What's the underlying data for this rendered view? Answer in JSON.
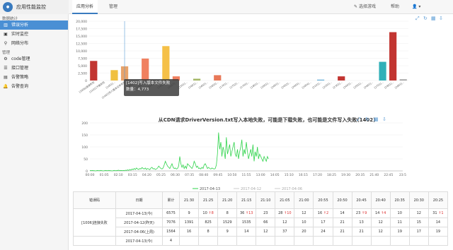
{
  "app": {
    "name": "应用性能监控"
  },
  "nav": {
    "tabs": [
      "应用分析",
      "管理"
    ],
    "right": [
      "选择游戏",
      "帮助"
    ]
  },
  "sidebar": {
    "sections": [
      {
        "title": "数据统计",
        "items": [
          {
            "label": "错误分析",
            "active": true,
            "icon": "chart-icon"
          },
          {
            "label": "实时监控",
            "active": false,
            "icon": "monitor-icon"
          },
          {
            "label": "网络分布",
            "active": false,
            "icon": "network-icon"
          }
        ]
      },
      {
        "title": "管理",
        "items": [
          {
            "label": "code管理",
            "active": false,
            "icon": "gear-icon"
          },
          {
            "label": "接口管理",
            "active": false,
            "icon": "list-icon"
          },
          {
            "label": "告警策略",
            "active": false,
            "icon": "policy-icon"
          },
          {
            "label": "告警查询",
            "active": false,
            "icon": "bell-icon"
          }
        ]
      }
    ]
  },
  "tooltip": {
    "line1": "[1402]写入版本文件失败",
    "line2": "数量：4,773"
  },
  "chart_data": [
    {
      "type": "bar",
      "title": "",
      "ylim": [
        0,
        20000
      ],
      "yticks": [
        "20,000",
        "17,500",
        "15,000",
        "12,500",
        "10,000",
        "7,500",
        "5,000",
        "2,500",
        "0"
      ],
      "categories": [
        "[1006]连接失败",
        "[1101]下载失败",
        "[1401]...",
        "[1402]写入版本文件失败",
        "[1403]...",
        "[1404]...",
        "[1405]...",
        "[1406]...",
        "[1407]...",
        "[1501]...",
        "[1601]...",
        "[1602]...",
        "[1603]...",
        "[1701]...",
        "[1702]...",
        "[1703]...",
        "[1801]...",
        "[1901]...",
        "[2001]...",
        "[2002]...",
        "[2003]...",
        "[2004]...",
        "[2101]...",
        "[2201]...",
        "[2301]...",
        "[2401]...",
        "[2501]...",
        "[2601]...",
        "[2701]...",
        "[2801]...",
        "[2901]..."
      ],
      "values": [
        6600,
        0,
        3500,
        4773,
        0,
        7400,
        0,
        11600,
        1400,
        0,
        600,
        0,
        1800,
        0,
        0,
        0,
        0,
        0,
        0,
        0,
        0,
        0,
        300,
        0,
        1400,
        0,
        0,
        0,
        6300,
        16300,
        400
      ],
      "colors": [
        "#c23531",
        "#c23531",
        "#f0c040",
        "#e8a36a",
        "#c23531",
        "#f08060",
        "#c23531",
        "#f5c048",
        "#f08060",
        "#c23531",
        "#a5b868",
        "#c23531",
        "#e87858",
        "#c23531",
        "#c23531",
        "#c23531",
        "#c23531",
        "#c23531",
        "#c23531",
        "#c23531",
        "#c23531",
        "#c23531",
        "#6ab0d8",
        "#c23531",
        "#c23531",
        "#c23531",
        "#c23531",
        "#c23531",
        "#30b0b8",
        "#c23531",
        "#a0a0a0"
      ]
    },
    {
      "type": "line",
      "title": "从CDN请求DriverVersion.txt写入本地失败，可能是下载失败，也可能是文件写入失败(1402)",
      "ylim": [
        0,
        200
      ],
      "yticks": [
        "200",
        "150",
        "100",
        "50",
        "0"
      ],
      "xticks": [
        "00:00",
        "01:05",
        "02:10",
        "03:15",
        "04:20",
        "05:25",
        "06:30",
        "07:35",
        "08:40",
        "09:45",
        "10:50",
        "11:55",
        "13:00",
        "14:05",
        "15:10",
        "16:15",
        "17:20",
        "18:25",
        "19:30",
        "20:35",
        "21:40",
        "22:45",
        "23:5"
      ],
      "series": [
        {
          "name": "2017-04-13",
          "color": "#2fd34b",
          "values": [
            2,
            1,
            2,
            1,
            1,
            0,
            1,
            2,
            1,
            1,
            2,
            1,
            0,
            1,
            2,
            1,
            1,
            2,
            1,
            1,
            0,
            1,
            2,
            1,
            1,
            2,
            3,
            1,
            2,
            1,
            2,
            1,
            3,
            2,
            4,
            2,
            6,
            3,
            8,
            5,
            10,
            6,
            12,
            8,
            6,
            10,
            8,
            14,
            10,
            8,
            12,
            6,
            10,
            8,
            5,
            12,
            15,
            8,
            10,
            6,
            8,
            12,
            20,
            15,
            10,
            8,
            12,
            25,
            40,
            30,
            20,
            15,
            10,
            20,
            30,
            15,
            10,
            12,
            8,
            10,
            20,
            60,
            30,
            15,
            25,
            10,
            20,
            10,
            30,
            25,
            20,
            15,
            10,
            20,
            40,
            30,
            15,
            20,
            10,
            12,
            8,
            15,
            10,
            25,
            30,
            20,
            10,
            15,
            10,
            8,
            12,
            10,
            8,
            10,
            25,
            70,
            160,
            90,
            120,
            60,
            100,
            80,
            50,
            140,
            70,
            90,
            110,
            60,
            80,
            100,
            120,
            70,
            60,
            90,
            50,
            80,
            100,
            130,
            60,
            90,
            70,
            120,
            80,
            50,
            70,
            90,
            60,
            110,
            40,
            80,
            60,
            100,
            50,
            70,
            60,
            50,
            40,
            60,
            50,
            40,
            60,
            50
          ]
        }
      ],
      "legend": [
        "2017-04-13",
        "2017-04-12",
        "2017-04-06"
      ],
      "legend_colors": [
        "#2fd34b",
        "#cccccc",
        "#cccccc"
      ]
    }
  ],
  "table": {
    "headers": [
      "错误码",
      "日期",
      "累计",
      "21:30",
      "21:25",
      "21:20",
      "21:15",
      "21:10",
      "21:05",
      "21:00",
      "20:55",
      "20:50",
      "20:45",
      "20:40",
      "20:35",
      "20:30",
      "20:25"
    ],
    "group_label": "[1006]连接失败",
    "rows": [
      {
        "date": "2017-04-13(今)",
        "total": "6575",
        "cells": [
          "9",
          "10 ↑8",
          "8",
          "36 ↑13",
          "23",
          "28 ↑10",
          "12",
          "16 ↑2",
          "14",
          "23 ↑9",
          "14 ↑4",
          "10",
          "12",
          "31 ↑1"
        ]
      },
      {
        "date": "2017-04-12(昨天)",
        "total": "7076",
        "cells": [
          "1391",
          "825",
          "1529",
          "1535",
          "66",
          "12",
          "10",
          "17",
          "21",
          "13",
          "12",
          "11",
          "15",
          "14"
        ]
      },
      {
        "date": "2017-04-06(上周)",
        "total": "1564",
        "cells": [
          "16",
          "8",
          "9",
          "14",
          "12",
          "37",
          "20",
          "24",
          "21",
          "21",
          "12",
          "19",
          "17",
          "19"
        ]
      },
      {
        "date": "2017-04-13(今)",
        "total": "4",
        "cells": [
          "",
          "",
          "",
          "",
          "",
          "",
          "",
          "",
          "",
          "",
          "",
          "",
          "",
          ""
        ]
      }
    ]
  }
}
